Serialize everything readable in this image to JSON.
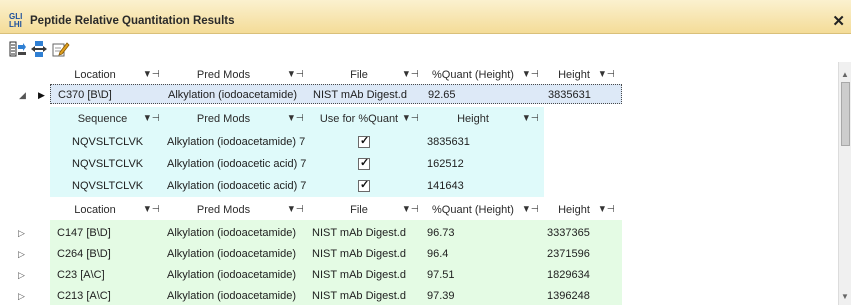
{
  "window": {
    "title": "Peptide Relative Quantitation Results",
    "close_glyph": "✕",
    "icon_text": "GLI\nLHI"
  },
  "toolbar": {
    "buttons": [
      "expand-all-icon",
      "collapse-all-icon",
      "edit-icon"
    ]
  },
  "colors": {
    "titlebar": "#f4dc98",
    "selected_row": "#dde9f7",
    "child_band": "#dffafa",
    "parent_rows": "#e4fbe4"
  },
  "filter_glyph": "▼⊣",
  "parent_header": [
    "Location",
    "Pred Mods",
    "File",
    "%Quant (Height)",
    "Height"
  ],
  "child_header": [
    "Sequence",
    "Pred Mods",
    "Use for %Quant",
    "Height"
  ],
  "top_group": {
    "expanded": true,
    "selected": true,
    "row": [
      "C370 [B\\D]",
      "Alkylation (iodoacetamide)",
      "NIST mAb Digest.d",
      "92.65",
      "3835631"
    ],
    "children": [
      {
        "sequence": "NQVSLTCLVK",
        "pred_mods": "Alkylation (iodoacetamide) 7",
        "use_for_quant": true,
        "height": "3835631"
      },
      {
        "sequence": "NQVSLTCLVK",
        "pred_mods": "Alkylation (iodoacetic acid) 7",
        "use_for_quant": true,
        "height": "162512"
      },
      {
        "sequence": "NQVSLTCLVK",
        "pred_mods": "Alkylation (iodoacetic acid) 7",
        "use_for_quant": true,
        "height": "141643"
      }
    ]
  },
  "rows": [
    [
      "C147 [B\\D]",
      "Alkylation (iodoacetamide)",
      "NIST mAb Digest.d",
      "96.73",
      "3337365"
    ],
    [
      "C264 [B\\D]",
      "Alkylation (iodoacetamide)",
      "NIST mAb Digest.d",
      "96.4",
      "2371596"
    ],
    [
      "C23 [A\\C]",
      "Alkylation (iodoacetamide)",
      "NIST mAb Digest.d",
      "97.51",
      "1829634"
    ],
    [
      "C213 [A\\C]",
      "Alkylation (iodoacetamide)",
      "NIST mAb Digest.d",
      "97.39",
      "1396248"
    ]
  ]
}
